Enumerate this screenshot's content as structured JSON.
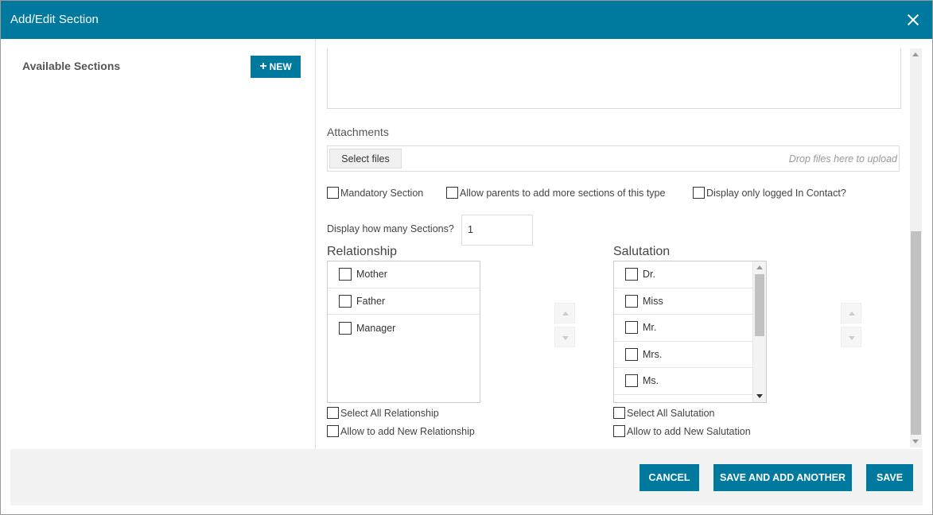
{
  "dialog": {
    "title": "Add/Edit Section"
  },
  "left": {
    "heading": "Available Sections",
    "new_button": "NEW"
  },
  "attachments": {
    "label": "Attachments",
    "select_files": "Select files",
    "drop_hint": "Drop files here to upload"
  },
  "options": {
    "mandatory": "Mandatory Section",
    "allow_more": "Allow parents to add more sections of this type",
    "logged_in": "Display only logged In Contact?"
  },
  "count": {
    "label": "Display how many Sections?",
    "value": "1"
  },
  "relationship": {
    "title": "Relationship",
    "items": [
      "Mother",
      "Father",
      "Manager"
    ],
    "select_all": "Select All Relationship",
    "allow_new": "Allow to add New Relationship"
  },
  "salutation": {
    "title": "Salutation",
    "items": [
      "Dr.",
      "Miss",
      "Mr.",
      "Mrs.",
      "Ms."
    ],
    "select_all": "Select All Salutation",
    "allow_new": "Allow to add New Salutation"
  },
  "footer": {
    "cancel": "CANCEL",
    "save_add": "SAVE AND ADD ANOTHER",
    "save": "SAVE"
  },
  "colors": {
    "accent": "#00799e",
    "footer_bg": "#f2f2f2"
  },
  "icons": {
    "close": "close-icon",
    "plus": "plus-icon",
    "checkbox": "checkbox-icon"
  }
}
